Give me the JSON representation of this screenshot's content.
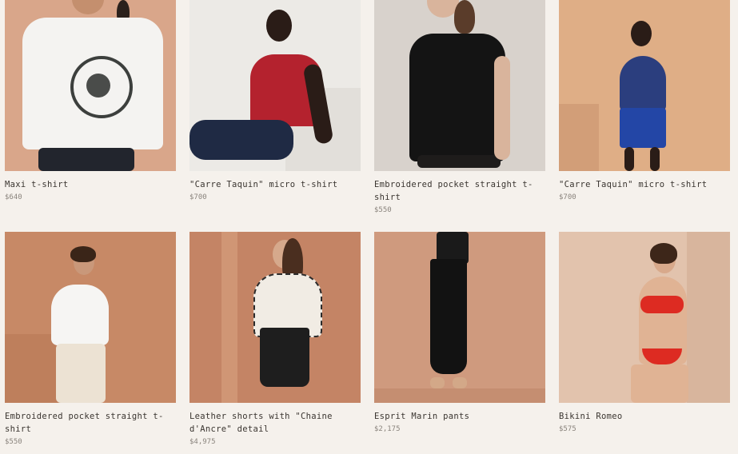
{
  "products": [
    {
      "name": "Maxi t-shirt",
      "price": "$640"
    },
    {
      "name": "\"Carre Taquin\" micro t-shirt",
      "price": "$700"
    },
    {
      "name": "Embroidered pocket straight t-shirt",
      "price": "$550"
    },
    {
      "name": "\"Carre Taquin\" micro t-shirt",
      "price": "$700"
    },
    {
      "name": "Embroidered pocket straight t-shirt",
      "price": "$550"
    },
    {
      "name": "Leather shorts with \"Chaine d'Ancre\" detail",
      "price": "$4,975"
    },
    {
      "name": "Esprit Marin pants",
      "price": "$2,175"
    },
    {
      "name": "Bikini Romeo",
      "price": "$575"
    }
  ]
}
